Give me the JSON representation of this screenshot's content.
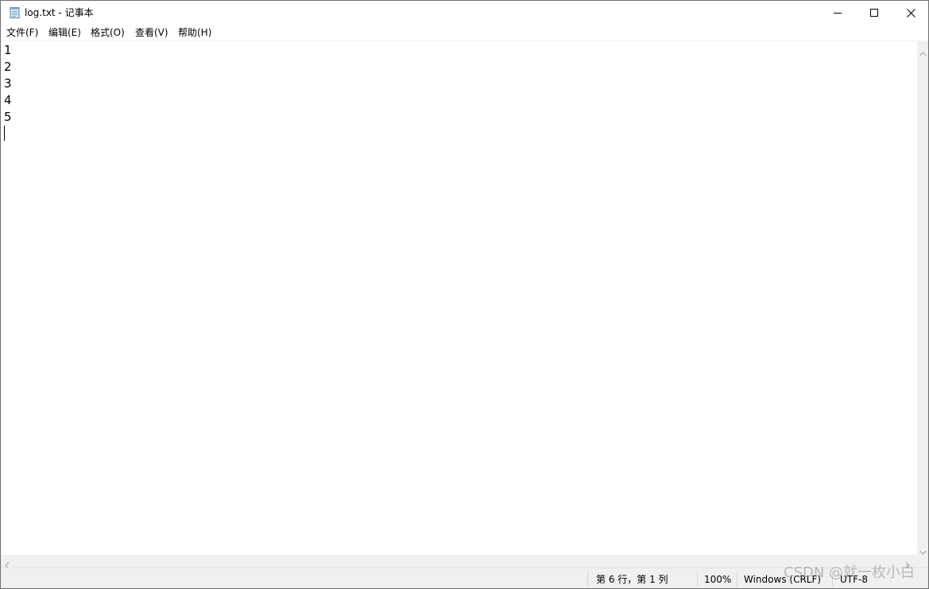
{
  "window": {
    "title": "log.txt - 记事本",
    "icon": "notepad-icon"
  },
  "menu": {
    "items": [
      {
        "label": "文件(F)"
      },
      {
        "label": "编辑(E)"
      },
      {
        "label": "格式(O)"
      },
      {
        "label": "查看(V)"
      },
      {
        "label": "帮助(H)"
      }
    ]
  },
  "editor": {
    "lines": [
      "1",
      "2",
      "3",
      "4",
      "5"
    ]
  },
  "status": {
    "position": "第 6 行，第 1 列",
    "zoom": "100%",
    "line_ending": "Windows (CRLF)",
    "encoding": "UTF-8"
  },
  "watermark": {
    "text": "CSDN @就一枚小白"
  },
  "colors": {
    "window_border": "#6e6e6e",
    "scrollbar_bg": "#f0f0f0",
    "statusbar_bg": "#f0f0f0"
  }
}
